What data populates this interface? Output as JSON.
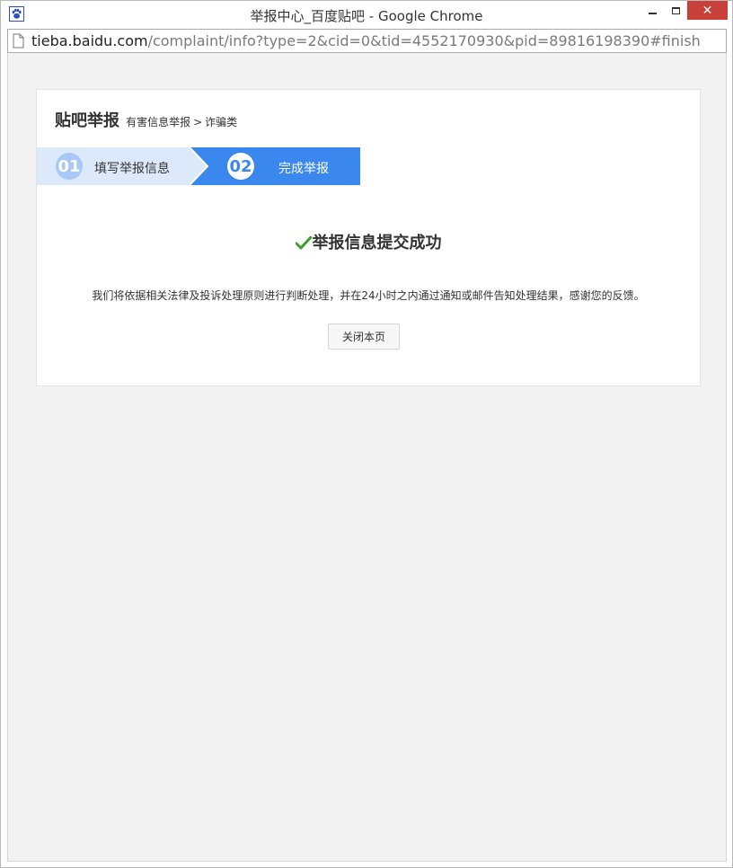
{
  "window": {
    "title": "举报中心_百度贴吧 - Google Chrome",
    "close_glyph": "✕"
  },
  "address_bar": {
    "host": "tieba.baidu.com",
    "path": "/complaint/info?type=2&cid=0&tid=4552170930&pid=89816198390#finish"
  },
  "page": {
    "title": "贴吧举报",
    "breadcrumb": [
      "有害信息举报",
      "诈骗类"
    ],
    "breadcrumb_separator": ">",
    "steps": [
      {
        "number": "01",
        "label": "填写举报信息",
        "active": false
      },
      {
        "number": "02",
        "label": "完成举报",
        "active": true
      }
    ],
    "success_title": "举报信息提交成功",
    "message": "我们将依据相关法律及投诉处理原则进行判断处理，并在24小时之内通过通知或邮件告知处理结果，感谢您的反馈。",
    "close_button_label": "关闭本页"
  },
  "colors": {
    "step_active": "#3a87ee",
    "step_inactive": "#dce9fb",
    "check": "#3aa02b",
    "close_button_bg": "#c7403a"
  }
}
